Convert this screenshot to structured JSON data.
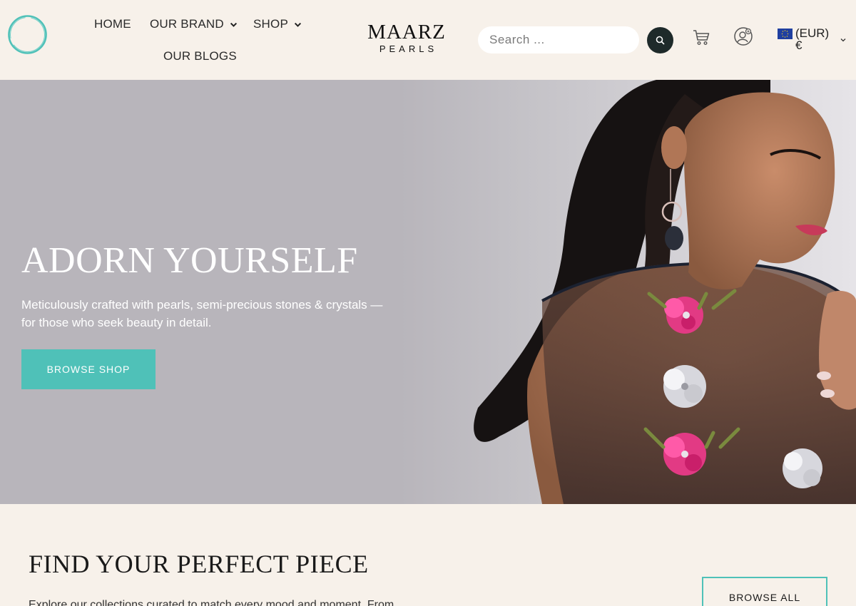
{
  "header": {
    "nav": [
      {
        "label": "HOME"
      },
      {
        "label": "OUR BRAND"
      },
      {
        "label": "SHOP"
      },
      {
        "label": "OUR BLOGS"
      }
    ],
    "brand": {
      "main": "MAARZ",
      "sub": "PEARLS"
    },
    "search": {
      "placeholder": "Search ..."
    },
    "currency": {
      "label": "(EUR)",
      "symbol": "€"
    }
  },
  "hero": {
    "title": "ADORN YOURSELF",
    "subtitle": "Meticulously crafted with pearls, semi-precious stones & crystals — for those who seek beauty in detail.",
    "button": "BROWSE SHOP"
  },
  "section": {
    "title": "FIND YOUR PERFECT PIECE",
    "text": "Explore our collections curated to match every mood and moment. From",
    "button": "BROWSE ALL"
  },
  "colors": {
    "background": "#f7f1ea",
    "accent": "#4fc1b8",
    "hero_bg": "#b8b5bb",
    "search_button": "#1e2a2a"
  },
  "icons": [
    "logo-ring-icon",
    "chevron-down-icon",
    "search-icon",
    "cart-icon",
    "account-icon",
    "eu-flag-icon"
  ]
}
